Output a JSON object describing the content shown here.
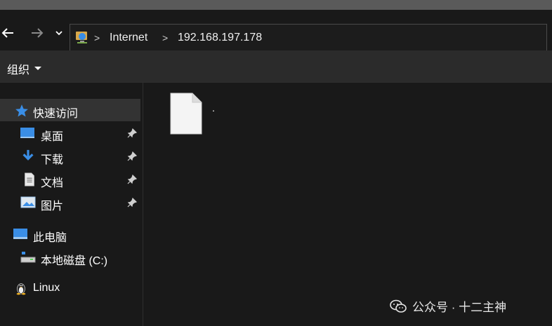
{
  "address_bar": {
    "crumbs": [
      "Internet",
      "192.168.197.178"
    ],
    "separator": ">"
  },
  "toolbar": {
    "organize_label": "组织"
  },
  "sidebar": {
    "quick_access": "快速访问",
    "items": [
      {
        "label": "桌面",
        "icon": "desktop-icon",
        "pinned": true
      },
      {
        "label": "下载",
        "icon": "download-icon",
        "pinned": true
      },
      {
        "label": "文档",
        "icon": "document-icon",
        "pinned": true
      },
      {
        "label": "图片",
        "icon": "pictures-icon",
        "pinned": true
      }
    ],
    "this_pc": "此电脑",
    "local_disk": "本地磁盘 (C:)",
    "linux": "Linux"
  },
  "content": {
    "files": [
      {
        "name": "."
      }
    ]
  },
  "watermark": {
    "text": "公众号 · 十二主神"
  },
  "colors": {
    "accent_blue": "#3a8ee6",
    "background": "#191919",
    "toolbar": "#2b2b2b",
    "selected": "#333333"
  }
}
